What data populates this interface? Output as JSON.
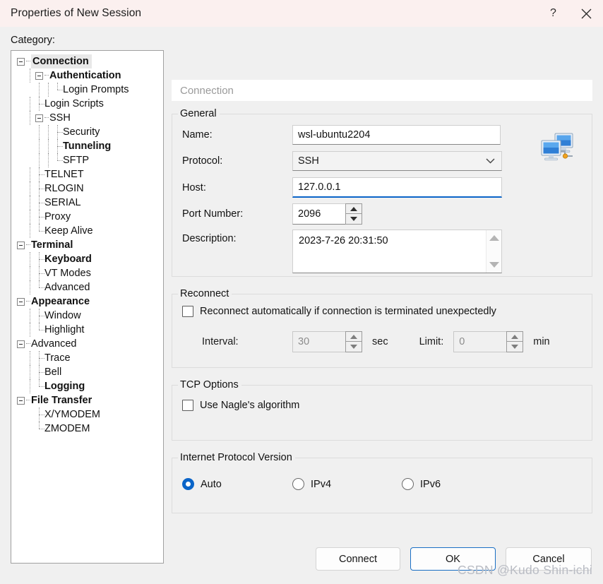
{
  "window": {
    "title": "Properties of New Session",
    "help_icon": "help-question-icon",
    "help_glyph": "?",
    "close_icon": "close-icon",
    "accent_color": "#0a64c8",
    "titlebar_color": "#fbf0ef"
  },
  "category": {
    "label": "Category:",
    "tree": [
      {
        "label": "Connection",
        "level": 0,
        "bold": true,
        "expander": true,
        "selected": true
      },
      {
        "label": "Authentication",
        "level": 1,
        "bold": true,
        "expander": true,
        "selected": false
      },
      {
        "label": "Login Prompts",
        "level": 2,
        "bold": false,
        "expander": false,
        "selected": false
      },
      {
        "label": "Login Scripts",
        "level": 1,
        "bold": false,
        "expander": false,
        "selected": false
      },
      {
        "label": "SSH",
        "level": 1,
        "bold": false,
        "expander": true,
        "selected": false
      },
      {
        "label": "Security",
        "level": 2,
        "bold": false,
        "expander": false,
        "selected": false
      },
      {
        "label": "Tunneling",
        "level": 2,
        "bold": true,
        "expander": false,
        "selected": false
      },
      {
        "label": "SFTP",
        "level": 2,
        "bold": false,
        "expander": false,
        "selected": false
      },
      {
        "label": "TELNET",
        "level": 1,
        "bold": false,
        "expander": false,
        "selected": false
      },
      {
        "label": "RLOGIN",
        "level": 1,
        "bold": false,
        "expander": false,
        "selected": false
      },
      {
        "label": "SERIAL",
        "level": 1,
        "bold": false,
        "expander": false,
        "selected": false
      },
      {
        "label": "Proxy",
        "level": 1,
        "bold": false,
        "expander": false,
        "selected": false
      },
      {
        "label": "Keep Alive",
        "level": 1,
        "bold": false,
        "expander": false,
        "selected": false
      },
      {
        "label": "Terminal",
        "level": 0,
        "bold": true,
        "expander": true,
        "selected": false
      },
      {
        "label": "Keyboard",
        "level": 1,
        "bold": true,
        "expander": false,
        "selected": false
      },
      {
        "label": "VT Modes",
        "level": 1,
        "bold": false,
        "expander": false,
        "selected": false
      },
      {
        "label": "Advanced",
        "level": 1,
        "bold": false,
        "expander": false,
        "selected": false
      },
      {
        "label": "Appearance",
        "level": 0,
        "bold": true,
        "expander": true,
        "selected": false
      },
      {
        "label": "Window",
        "level": 1,
        "bold": false,
        "expander": false,
        "selected": false
      },
      {
        "label": "Highlight",
        "level": 1,
        "bold": false,
        "expander": false,
        "selected": false
      },
      {
        "label": "Advanced",
        "level": 0,
        "bold": false,
        "expander": true,
        "selected": false
      },
      {
        "label": "Trace",
        "level": 1,
        "bold": false,
        "expander": false,
        "selected": false
      },
      {
        "label": "Bell",
        "level": 1,
        "bold": false,
        "expander": false,
        "selected": false
      },
      {
        "label": "Logging",
        "level": 1,
        "bold": true,
        "expander": false,
        "selected": false
      },
      {
        "label": "File Transfer",
        "level": 0,
        "bold": true,
        "expander": true,
        "selected": false
      },
      {
        "label": "X/YMODEM",
        "level": 1,
        "bold": false,
        "expander": false,
        "selected": false
      },
      {
        "label": "ZMODEM",
        "level": 1,
        "bold": false,
        "expander": false,
        "selected": false
      }
    ]
  },
  "page": {
    "header": "Connection",
    "general": {
      "title": "General",
      "name_label": "Name:",
      "name_value": "wsl-ubuntu2204",
      "protocol_label": "Protocol:",
      "protocol_value": "SSH",
      "protocol_chevron_icon": "chevron-down-icon",
      "host_label": "Host:",
      "host_value": "127.0.0.1",
      "port_label": "Port Number:",
      "port_value": "2096",
      "description_label": "Description:",
      "description_value": "2023-7-26 20:31:50",
      "session_icon": "remote-computers-icon"
    },
    "reconnect": {
      "title": "Reconnect",
      "auto_label": "Reconnect automatically if connection is terminated unexpectedly",
      "auto_checked": false,
      "interval_label": "Interval:",
      "interval_value": "30",
      "interval_unit": "sec",
      "limit_label": "Limit:",
      "limit_value": "0",
      "limit_unit": "min"
    },
    "tcp_options": {
      "title": "TCP Options",
      "nagle_label": "Use Nagle's algorithm",
      "nagle_checked": false
    },
    "ip_version": {
      "title": "Internet Protocol Version",
      "options": [
        {
          "label": "Auto",
          "selected": true
        },
        {
          "label": "IPv4",
          "selected": false
        },
        {
          "label": "IPv6",
          "selected": false
        }
      ]
    }
  },
  "footer": {
    "connect_label": "Connect",
    "ok_label": "OK",
    "cancel_label": "Cancel"
  },
  "watermark": "CSDN @Kudo Shin-ichi"
}
